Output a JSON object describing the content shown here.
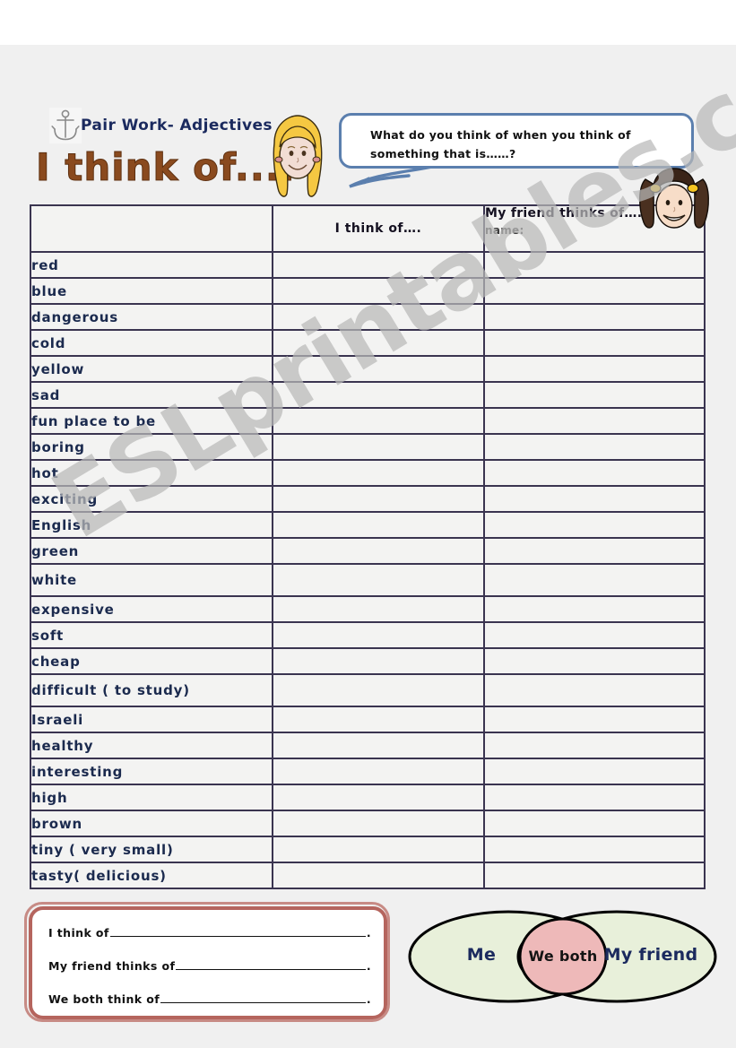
{
  "header": {
    "anchor_icon": "anchor-icon",
    "subtitle": "Pair Work- Adjectives",
    "title": "I think of....",
    "speech_bubble": "What do you think of when you think of something that is……?"
  },
  "table": {
    "columns": [
      {
        "key": "adjective",
        "label": ""
      },
      {
        "key": "me",
        "label": "I think of…."
      },
      {
        "key": "friend",
        "label": "My friend thinks of…."
      }
    ],
    "friend_name_label": "name:",
    "rows": [
      {
        "adjective": "red",
        "me": "",
        "friend": ""
      },
      {
        "adjective": "blue",
        "me": "",
        "friend": ""
      },
      {
        "adjective": "dangerous",
        "me": "",
        "friend": ""
      },
      {
        "adjective": "cold",
        "me": "",
        "friend": ""
      },
      {
        "adjective": "yellow",
        "me": "",
        "friend": ""
      },
      {
        "adjective": "sad",
        "me": "",
        "friend": ""
      },
      {
        "adjective": "fun place to be",
        "me": "",
        "friend": ""
      },
      {
        "adjective": "boring",
        "me": "",
        "friend": ""
      },
      {
        "adjective": "hot",
        "me": "",
        "friend": ""
      },
      {
        "adjective": "exciting",
        "me": "",
        "friend": ""
      },
      {
        "adjective": "English",
        "me": "",
        "friend": ""
      },
      {
        "adjective": "green",
        "me": "",
        "friend": ""
      },
      {
        "adjective": "white",
        "me": "",
        "friend": ""
      },
      {
        "adjective": "expensive",
        "me": "",
        "friend": ""
      },
      {
        "adjective": "soft",
        "me": "",
        "friend": ""
      },
      {
        "adjective": "cheap",
        "me": "",
        "friend": ""
      },
      {
        "adjective": "difficult ( to study)",
        "me": "",
        "friend": ""
      },
      {
        "adjective": "Israeli",
        "me": "",
        "friend": ""
      },
      {
        "adjective": "healthy",
        "me": "",
        "friend": ""
      },
      {
        "adjective": "interesting",
        "me": "",
        "friend": ""
      },
      {
        "adjective": "high",
        "me": "",
        "friend": ""
      },
      {
        "adjective": "brown",
        "me": "",
        "friend": ""
      },
      {
        "adjective": "tiny ( very small)",
        "me": "",
        "friend": ""
      },
      {
        "adjective": "tasty( delicious)",
        "me": "",
        "friend": ""
      }
    ]
  },
  "sentences": [
    {
      "prefix": "I think of",
      "suffix": "."
    },
    {
      "prefix": "My friend thinks of",
      "suffix": "."
    },
    {
      "prefix": "We both think of",
      "suffix": "."
    }
  ],
  "venn": {
    "left_label": "Me",
    "center_label": "We both",
    "right_label": "My friend"
  },
  "watermark": "ESLprintables.com",
  "colors": {
    "sheet_background": "#f0f0f0",
    "table_border": "#3a3450",
    "cell_background": "#f3f3f2",
    "header_me": "#c9bfdd",
    "header_friend": "#fcdcc0",
    "adjective_text": "#1b2a4e",
    "title": "#8a4a1e",
    "subtitle": "#1b2a5e",
    "bubble_outline": "#5b7fae",
    "sentence_box_border": "#b5655e",
    "venn_outer": "#e8f0da",
    "venn_center": "#eeb9b9",
    "watermark": "#b9b9b9"
  }
}
